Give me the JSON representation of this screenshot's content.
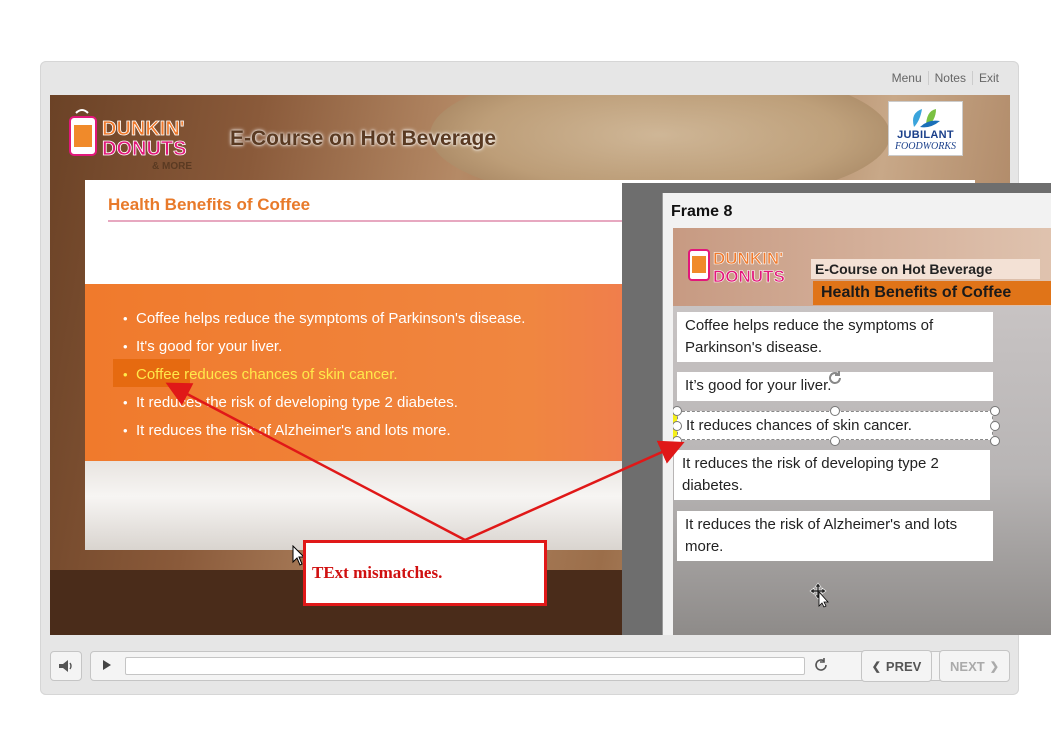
{
  "topnav": {
    "menu": "Menu",
    "notes": "Notes",
    "exit": "Exit"
  },
  "header": {
    "brand_line1": "DUNKIN'",
    "brand_line2": "DONUTS",
    "brand_more": "& MORE",
    "course_title": "E-Course on Hot Beverage",
    "partner_line1": "JUBILANT",
    "partner_line2": "FOODWORKS"
  },
  "slide": {
    "heading": "Health Benefits of Coffee",
    "bullets": [
      "Coffee helps reduce the symptoms of Parkinson's disease.",
      "It's good for your liver.",
      "Coffee reduces chances of skin cancer.",
      "It reduces the risk of developing type 2 diabetes.",
      "It reduces the risk of Alzheimer's and lots more."
    ]
  },
  "player": {
    "prev_label": "PREV",
    "next_label": "NEXT"
  },
  "frame8": {
    "title": "Frame 8",
    "brand_line1": "DUNKIN'",
    "brand_line2": "DONUTS",
    "course_title": "E-Course on Hot Beverage",
    "heading": "Health Benefits of Coffee",
    "items": [
      "Coffee helps reduce the symptoms of Parkinson's disease.",
      "It’s good for your liver.",
      "It reduces chances of skin cancer.",
      "It reduces the risk of developing type 2 diabetes.",
      "It reduces the risk of Alzheimer's and lots more."
    ]
  },
  "callout": {
    "text": "TExt mismatches."
  },
  "colors": {
    "accent_orange": "#f07a2c",
    "callout_red": "#e01818",
    "highlight_yellow": "#f5ef1a"
  }
}
